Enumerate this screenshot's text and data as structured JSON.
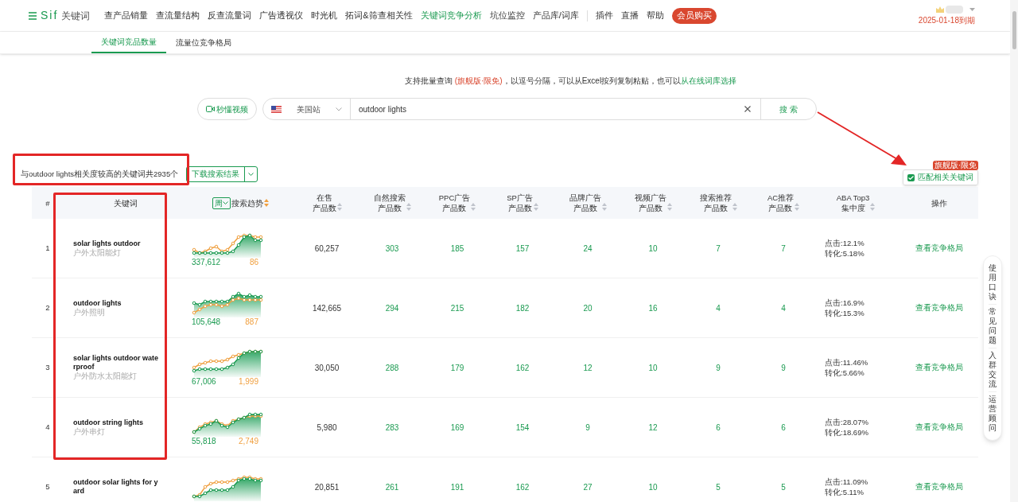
{
  "logo": {
    "text": "Sif",
    "product": "关键词"
  },
  "nav": [
    {
      "label": "查产品销量",
      "selected": false
    },
    {
      "label": "查流量结构",
      "selected": false
    },
    {
      "label": "反查流量词",
      "selected": false
    },
    {
      "label": "广告透视仪",
      "selected": false
    },
    {
      "label": "时光机",
      "selected": false
    },
    {
      "label": "拓词&筛查相关性",
      "selected": false
    },
    {
      "label": "关键词竞争分析",
      "selected": true
    },
    {
      "label": "坑位监控",
      "selected": false
    },
    {
      "label": "产品库/词库",
      "selected": false
    }
  ],
  "nav_extra": [
    "插件",
    "直播",
    "帮助"
  ],
  "member_button": "会员购买",
  "account": {
    "expiry": "2025-01-18到期"
  },
  "subtabs": [
    {
      "label": "关键词竞品数量",
      "selected": true
    },
    {
      "label": "流量位竞争格局",
      "selected": false
    }
  ],
  "search_hint": {
    "text": "支持批量查询 ",
    "badge": "(旗舰版·限免)",
    "rest": "，以逗号分隔，可以从Excel按列复制粘贴，也可以",
    "link": "从在线词库选择"
  },
  "video_button": "秒懂视频",
  "marketplace": "美国站",
  "search": {
    "value": "outdoor lights",
    "button": "搜 索"
  },
  "summary": "与outdoor lights相关度较高的关键词共2935个",
  "download_button": "下载搜索结果",
  "match_option": {
    "label": "匹配相关关键词",
    "checked": true,
    "badge": "旗舰版·限免"
  },
  "table": {
    "columns": [
      {
        "lines": [
          "#"
        ],
        "sortable": false
      },
      {
        "lines": [
          "关键词"
        ],
        "sortable": false
      },
      {
        "lines": [
          "搜索趋势"
        ],
        "sortable": true,
        "period": "周"
      },
      {
        "lines": [
          "在售",
          "产品数"
        ],
        "sortable": true
      },
      {
        "lines": [
          "自然搜索",
          "产品数"
        ],
        "sortable": true
      },
      {
        "lines": [
          "PPC广告",
          "产品数"
        ],
        "sortable": true
      },
      {
        "lines": [
          "SP广告",
          "产品数"
        ],
        "sortable": true
      },
      {
        "lines": [
          "品牌广告",
          "产品数"
        ],
        "sortable": true
      },
      {
        "lines": [
          "视频广告",
          "产品数"
        ],
        "sortable": true
      },
      {
        "lines": [
          "搜索推荐",
          "产品数"
        ],
        "sortable": true
      },
      {
        "lines": [
          "AC推荐",
          "产品数"
        ],
        "sortable": true
      },
      {
        "lines": [
          "ABA Top3",
          "集中度"
        ],
        "sortable": true
      },
      {
        "lines": [
          "操作"
        ],
        "sortable": false
      }
    ],
    "rows": [
      {
        "rank": "1",
        "keyword": "solar lights outdoor",
        "translation": "户外太阳能灯",
        "search_volume": "337,612",
        "product_count": "86",
        "counts": [
          "60,257",
          "303",
          "185",
          "157",
          "24",
          "10",
          "7",
          "7"
        ],
        "click": "点击:12.1%",
        "conversion": "转化:5.18%",
        "action": "查看竞争格局"
      },
      {
        "rank": "2",
        "keyword": "outdoor lights",
        "translation": "户外照明",
        "search_volume": "105,648",
        "product_count": "887",
        "counts": [
          "142,665",
          "294",
          "215",
          "182",
          "20",
          "16",
          "4",
          "4"
        ],
        "click": "点击:16.9%",
        "conversion": "转化:15.3%",
        "action": "查看竞争格局"
      },
      {
        "rank": "3",
        "keyword": "solar lights outdoor waterproof",
        "translation": "户外防水太阳能灯",
        "search_volume": "67,006",
        "product_count": "1,999",
        "counts": [
          "30,050",
          "288",
          "179",
          "162",
          "12",
          "10",
          "9",
          "9"
        ],
        "click": "点击:11.46%",
        "conversion": "转化:5.66%",
        "action": "查看竞争格局"
      },
      {
        "rank": "4",
        "keyword": "outdoor string lights",
        "translation": "户外串灯",
        "search_volume": "55,818",
        "product_count": "2,749",
        "counts": [
          "5,980",
          "283",
          "169",
          "154",
          "9",
          "12",
          "6",
          "6"
        ],
        "click": "点击:28.07%",
        "conversion": "转化:18.69%",
        "action": "查看竞争格局"
      },
      {
        "rank": "5",
        "keyword": "outdoor solar lights for yard",
        "counts": [
          "20,851",
          "261",
          "191",
          "162",
          "27",
          "10",
          "5",
          "5"
        ],
        "click": "点击:11.09%",
        "conversion": "转化:5.11%",
        "action": "查看竞争格局"
      }
    ]
  },
  "side_panel": [
    "使用口诀",
    "常见问题",
    "入群交流",
    "运营顾问"
  ]
}
